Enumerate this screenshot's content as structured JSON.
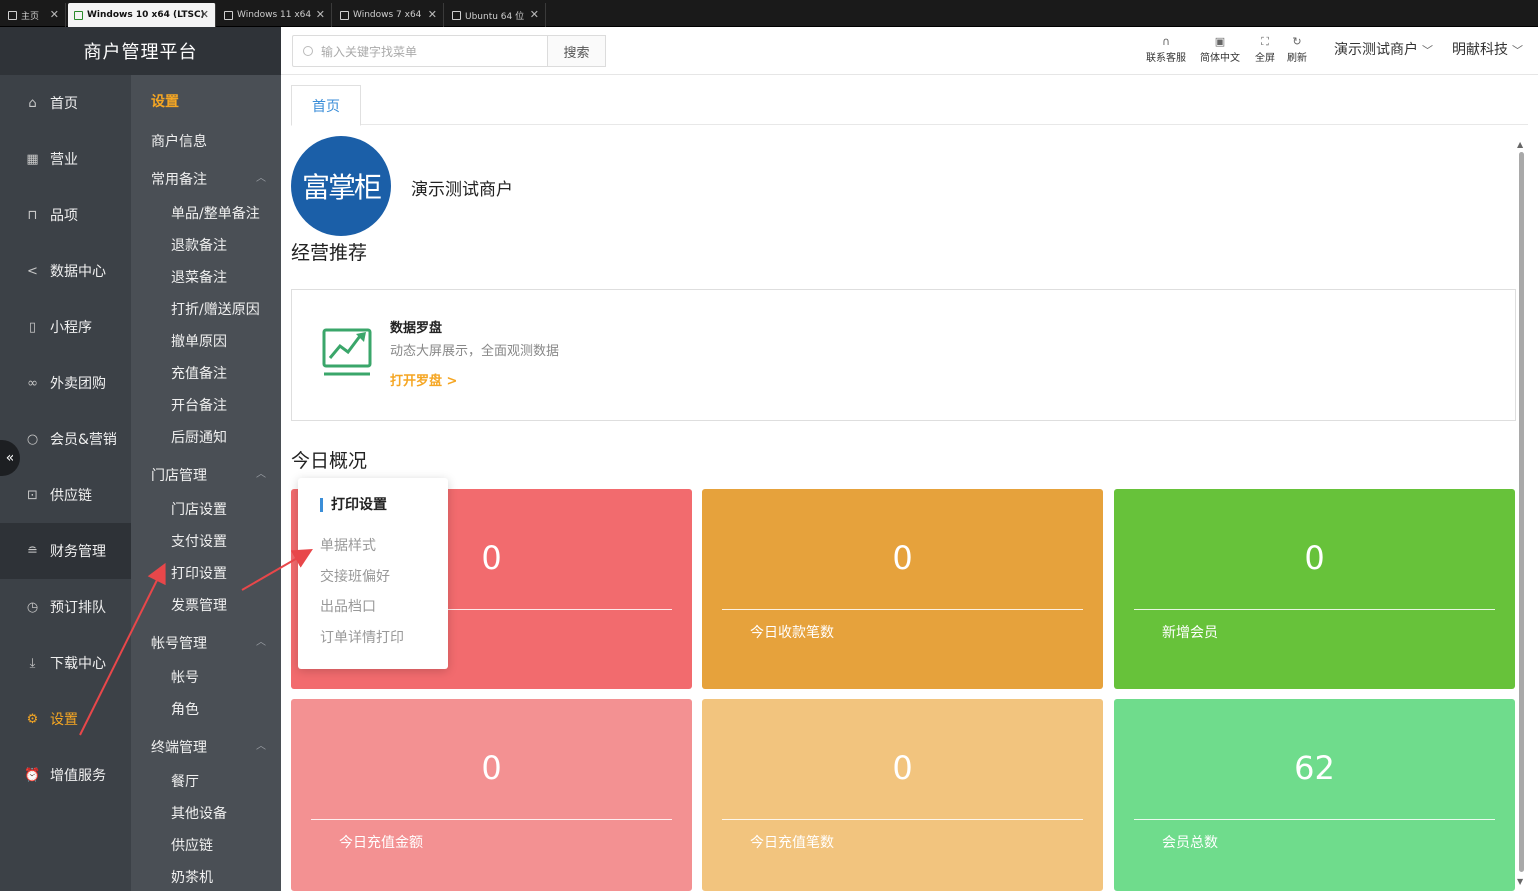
{
  "vm_tabs": [
    {
      "label": "主页"
    },
    {
      "label": "Windows 10 x64 (LTSC)"
    },
    {
      "label": "Windows 11 x64"
    },
    {
      "label": "Windows 7 x64"
    },
    {
      "label": "Ubuntu 64 位"
    }
  ],
  "brand": "商户管理平台",
  "nav": [
    {
      "label": "首页",
      "icon": "home-icon"
    },
    {
      "label": "营业",
      "icon": "calendar-icon"
    },
    {
      "label": "品项",
      "icon": "bag-icon"
    },
    {
      "label": "数据中心",
      "icon": "share-icon"
    },
    {
      "label": "小程序",
      "icon": "phone-icon"
    },
    {
      "label": "外卖团购",
      "icon": "bike-icon"
    },
    {
      "label": "会员&营销",
      "icon": "user-icon"
    },
    {
      "label": "供应链",
      "icon": "truck-icon"
    },
    {
      "label": "财务管理",
      "icon": "database-icon"
    },
    {
      "label": "预订排队",
      "icon": "clock-icon"
    },
    {
      "label": "下载中心",
      "icon": "download-icon"
    },
    {
      "label": "设置",
      "icon": "gear-icon"
    },
    {
      "label": "增值服务",
      "icon": "alarm-icon"
    }
  ],
  "subnav": {
    "title": "设置",
    "merchant_info": "商户信息",
    "groups": [
      {
        "label": "常用备注",
        "items": [
          "单品/整单备注",
          "退款备注",
          "退菜备注",
          "打折/赠送原因",
          "撤单原因",
          "充值备注",
          "开台备注",
          "后厨通知"
        ]
      },
      {
        "label": "门店管理",
        "items": [
          "门店设置",
          "支付设置",
          "打印设置",
          "发票管理"
        ]
      },
      {
        "label": "帐号管理",
        "items": [
          "帐号",
          "角色"
        ]
      },
      {
        "label": "终端管理",
        "items": [
          "餐厅",
          "其他设备",
          "供应链",
          "奶茶机"
        ]
      }
    ]
  },
  "header": {
    "search_placeholder": "输入关键字找菜单",
    "search_button": "搜索",
    "tools": [
      {
        "label": "联系客服",
        "icon": "headset-icon"
      },
      {
        "label": "简体中文",
        "icon": "translate-icon"
      },
      {
        "label": "全屏",
        "icon": "fullscreen-icon"
      },
      {
        "label": "刷新",
        "icon": "refresh-icon"
      }
    ],
    "merchant_select": "演示测试商户",
    "company_select": "明献科技"
  },
  "content": {
    "home_tab": "首页",
    "logo_text": "富掌柜",
    "merchant_name": "演示测试商户",
    "recommend_title": "经营推荐",
    "compass": {
      "title": "数据罗盘",
      "desc": "动态大屏展示，全面观测数据",
      "link": "打开罗盘 >"
    },
    "today_title": "今日概况",
    "stats": [
      {
        "value": "0",
        "label": "",
        "color": "#f26b6e"
      },
      {
        "value": "0",
        "label": "今日收款笔数",
        "color": "#e6a23c"
      },
      {
        "value": "0",
        "label": "新增会员",
        "color": "#67c23a"
      },
      {
        "value": "0",
        "label": "今日充值金额",
        "color": "#f39192"
      },
      {
        "value": "0",
        "label": "今日充值笔数",
        "color": "#f2c47e"
      },
      {
        "value": "62",
        "label": "会员总数",
        "color": "#6fdc8c"
      }
    ]
  },
  "popup": {
    "title": "打印设置",
    "items": [
      "单据样式",
      "交接班偏好",
      "出品档口",
      "订单详情打印"
    ]
  },
  "colors": {
    "accent": "#f5a623",
    "link_blue": "#3b8ed8",
    "annotation_arrow": "#e8474a"
  }
}
